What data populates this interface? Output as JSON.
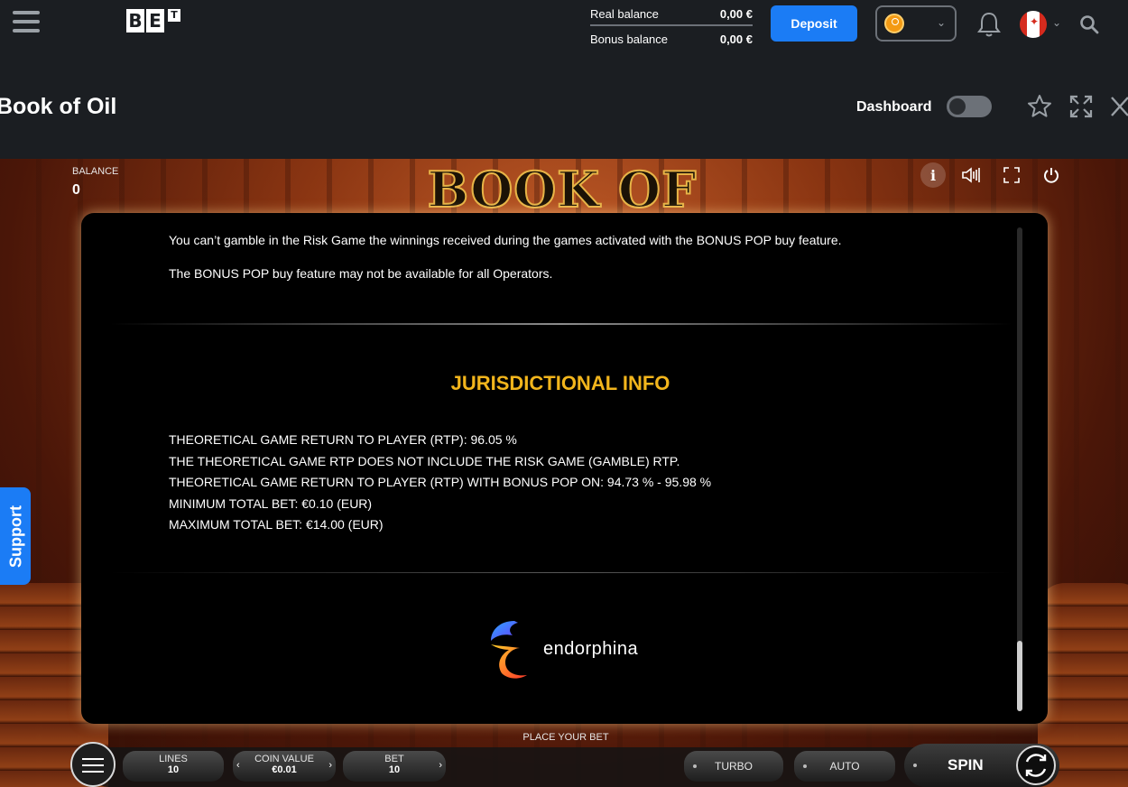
{
  "header": {
    "logo": {
      "letters": [
        "B",
        "E"
      ],
      "superscript": "T"
    },
    "real_balance_label": "Real balance",
    "real_balance_value": "0,00 €",
    "bonus_balance_label": "Bonus balance",
    "bonus_balance_value": "0,00 €",
    "deposit_label": "Deposit",
    "account_icon": "user-avatar-icon",
    "notification_icon": "bell-icon",
    "language_icon": "canada-flag-icon",
    "search_icon": "search-icon"
  },
  "gamebar": {
    "title": "Book of Oil",
    "dashboard_label": "Dashboard",
    "dashboard_on": false,
    "favorite_icon": "star-icon",
    "fullscreen_icon": "expand-icon",
    "close_icon": "close-icon"
  },
  "game": {
    "balance_label": "BALANCE",
    "balance_value": "0",
    "logo_text": "BOOK OF OIL",
    "info_icon_glyph": "i"
  },
  "modal": {
    "paragraphs": [
      "You can’t gamble in the Risk Game the winnings received during the games activated with the BONUS POP buy feature.",
      "The BONUS POP buy feature may not be available for all Operators."
    ],
    "heading": "JURISDICTIONAL INFO",
    "info_lines": [
      "THEORETICAL GAME RETURN TO PLAYER (RTP): 96.05 %",
      "THE THEORETICAL GAME RTP DOES NOT INCLUDE THE RISK GAME (GAMBLE) RTP.",
      "THEORETICAL GAME RETURN TO PLAYER (RTP) WITH BONUS POP ON: 94.73 % - 95.98 %",
      "MINIMUM TOTAL BET: €0.10 (EUR)",
      "MAXIMUM TOTAL BET: €14.00 (EUR)"
    ],
    "provider_name": "endorphina"
  },
  "support_label": "Support",
  "controls": {
    "place_bet": "PLACE YOUR BET",
    "lines_label": "LINES",
    "lines_value": "10",
    "coin_label": "COIN VALUE",
    "coin_value": "€0.01",
    "bet_label": "BET",
    "bet_value": "10",
    "turbo_label": "TURBO",
    "auto_label": "AUTO",
    "spin_label": "SPIN",
    "arrow_left": "‹",
    "arrow_right": "›"
  },
  "colors": {
    "accent_blue": "#1b7cf5",
    "heading_gold": "#f2b51c",
    "header_bg": "#1b1e22"
  }
}
